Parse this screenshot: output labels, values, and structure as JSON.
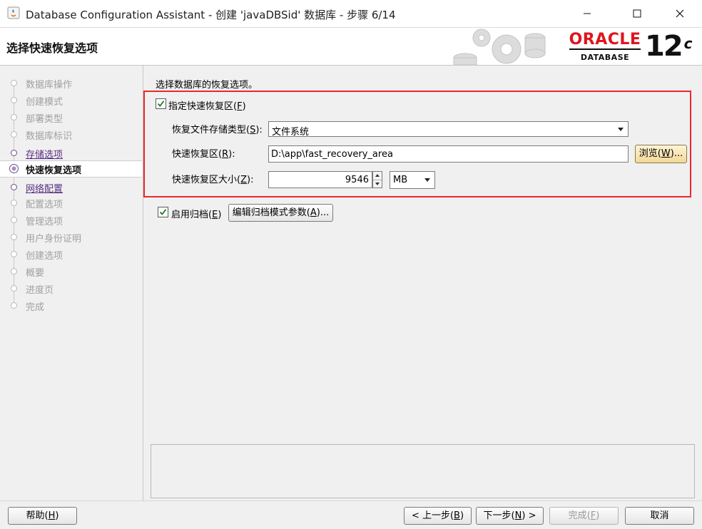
{
  "window": {
    "title": "Database Configuration Assistant - 创建 'javaDBSid' 数据库 - 步骤 6/14",
    "minimize_icon": "minimize-icon",
    "maximize_icon": "maximize-icon",
    "close_icon": "close-icon"
  },
  "header": {
    "step_title": "选择快速恢复选项",
    "logo_brand": "ORACLE",
    "logo_sub": "DATABASE",
    "logo_version": "12",
    "logo_version_sup": "c"
  },
  "nav": {
    "items": [
      {
        "label": "数据库操作",
        "state": "inactive"
      },
      {
        "label": "创建模式",
        "state": "inactive"
      },
      {
        "label": "部署类型",
        "state": "inactive"
      },
      {
        "label": "数据库标识",
        "state": "inactive"
      },
      {
        "label": "存储选项",
        "state": "done"
      },
      {
        "label": "快速恢复选项",
        "state": "current"
      },
      {
        "label": "网络配置",
        "state": "done"
      },
      {
        "label": "配置选项",
        "state": "inactive"
      },
      {
        "label": "管理选项",
        "state": "inactive"
      },
      {
        "label": "用户身份证明",
        "state": "inactive"
      },
      {
        "label": "创建选项",
        "state": "inactive"
      },
      {
        "label": "概要",
        "state": "inactive"
      },
      {
        "label": "进度页",
        "state": "inactive"
      },
      {
        "label": "完成",
        "state": "inactive"
      }
    ]
  },
  "main": {
    "intro": "选择数据库的恢复选项。",
    "fra_checkbox": {
      "label": "指定快速恢复区",
      "mnemonic": "F",
      "checked": true
    },
    "storage_type": {
      "label": "恢复文件存储类型",
      "mnemonic": "S",
      "value": "文件系统"
    },
    "fra_location": {
      "label": "快速恢复区",
      "mnemonic": "R",
      "value": "D:\\app\\fast_recovery_area"
    },
    "browse_button": {
      "label": "浏览",
      "mnemonic": "W",
      "suffix": "..."
    },
    "fra_size": {
      "label": "快速恢复区大小",
      "mnemonic": "Z",
      "value": "9546",
      "unit": "MB"
    },
    "archive_checkbox": {
      "label": "启用归档",
      "mnemonic": "E",
      "checked": true
    },
    "archive_params_button": {
      "label": "编辑归档模式参数",
      "mnemonic": "A",
      "suffix": "..."
    }
  },
  "footer": {
    "help": {
      "label": "帮助",
      "mnemonic": "H"
    },
    "back": {
      "prefix": "< 上一步",
      "mnemonic": "B"
    },
    "next": {
      "prefix": "下一步",
      "mnemonic": "N",
      "suffix": " >"
    },
    "finish": {
      "label": "完成",
      "mnemonic": "F"
    },
    "cancel": {
      "label": "取消"
    }
  },
  "colors": {
    "highlight_box": "#e8292d",
    "oracle_red": "#e0141e",
    "nav_done": "#5a2d82",
    "checkbox_check": "#1f7a1f"
  }
}
